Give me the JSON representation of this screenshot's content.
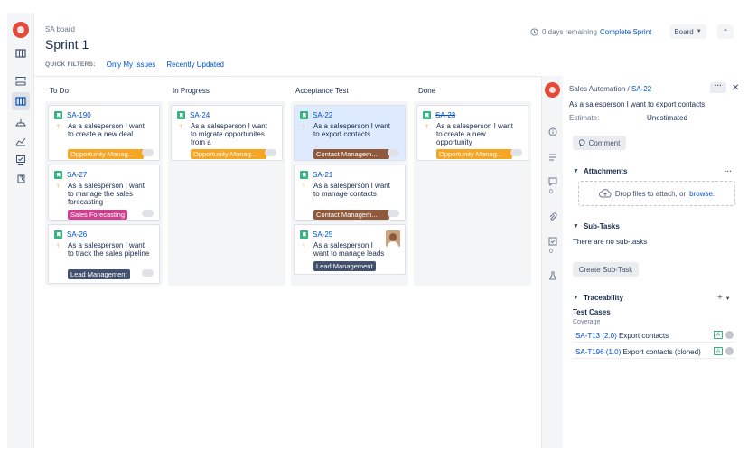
{
  "header": {
    "breadcrumb": "SA board",
    "title": "Sprint 1",
    "quick_filters_label": "QUICK FILTERS:",
    "quick_filters": [
      "Only My Issues",
      "Recently Updated"
    ],
    "remaining": "0 days remaining",
    "complete_sprint": "Complete Sprint",
    "board_button": "Board"
  },
  "columns": [
    {
      "name": "To Do"
    },
    {
      "name": "In Progress"
    },
    {
      "name": "Acceptance Test"
    },
    {
      "name": "Done"
    }
  ],
  "cards": {
    "todo": [
      {
        "key": "SA-190",
        "summary": "As a salesperson I want to create a new deal",
        "epic": "Opportunity Manag..."
      },
      {
        "key": "SA-27",
        "summary": "As a salesperson I want to manage the sales forecasting",
        "epic": "Sales Forecasting"
      },
      {
        "key": "SA-26",
        "summary": "As a salesperson I want to track the sales pipeline",
        "epic": "Lead Management"
      }
    ],
    "inprogress": [
      {
        "key": "SA-24",
        "summary": "As a salesperson I want to migrate opportunites from a",
        "epic": "Opportunity Manag..."
      }
    ],
    "acceptance": [
      {
        "key": "SA-22",
        "summary": "As a salesperson I want to export contacts",
        "epic": "Contact Managem..."
      },
      {
        "key": "SA-21",
        "summary": "As a salesperson I want to manage contacts",
        "epic": "Contact Managem..."
      },
      {
        "key": "SA-25",
        "summary": "As a salesperson I want to manage leads",
        "epic": "Lead Management"
      }
    ],
    "done": [
      {
        "key": "SA-23",
        "summary": "As a salesperson I want to create a new opportunity",
        "epic": "Opportunity Manag..."
      }
    ]
  },
  "epic_colors": {
    "opportunity": "#f6a623",
    "forecasting": "#cd3f8e",
    "lead": "#42526e",
    "contact": "#8f5a3c"
  },
  "panel": {
    "project": "Sales Automation",
    "separator": " / ",
    "issue_key": "SA-22",
    "summary": "As a salesperson I want to export contacts",
    "estimate_label": "Estimate:",
    "estimate_value": "Unestimated",
    "comment_button": "Comment",
    "attachments_title": "Attachments",
    "drop_text": "Drop files to attach, or",
    "browse": "browse.",
    "subtasks_title": "Sub-Tasks",
    "no_subtasks": "There are no sub-tasks",
    "create_subtask": "Create Sub-Task",
    "traceability_title": "Traceability",
    "test_cases_title": "Test Cases",
    "coverage_label": "Coverage",
    "test_cases": [
      {
        "key": "SA-T13 (2.0)",
        "name": " Export contacts",
        "badge": "A"
      },
      {
        "key": "SA-T196 (1.0)",
        "name": " Export contacts (cloned)",
        "badge": "A"
      }
    ],
    "rail_counts": [
      "0",
      "0"
    ]
  }
}
